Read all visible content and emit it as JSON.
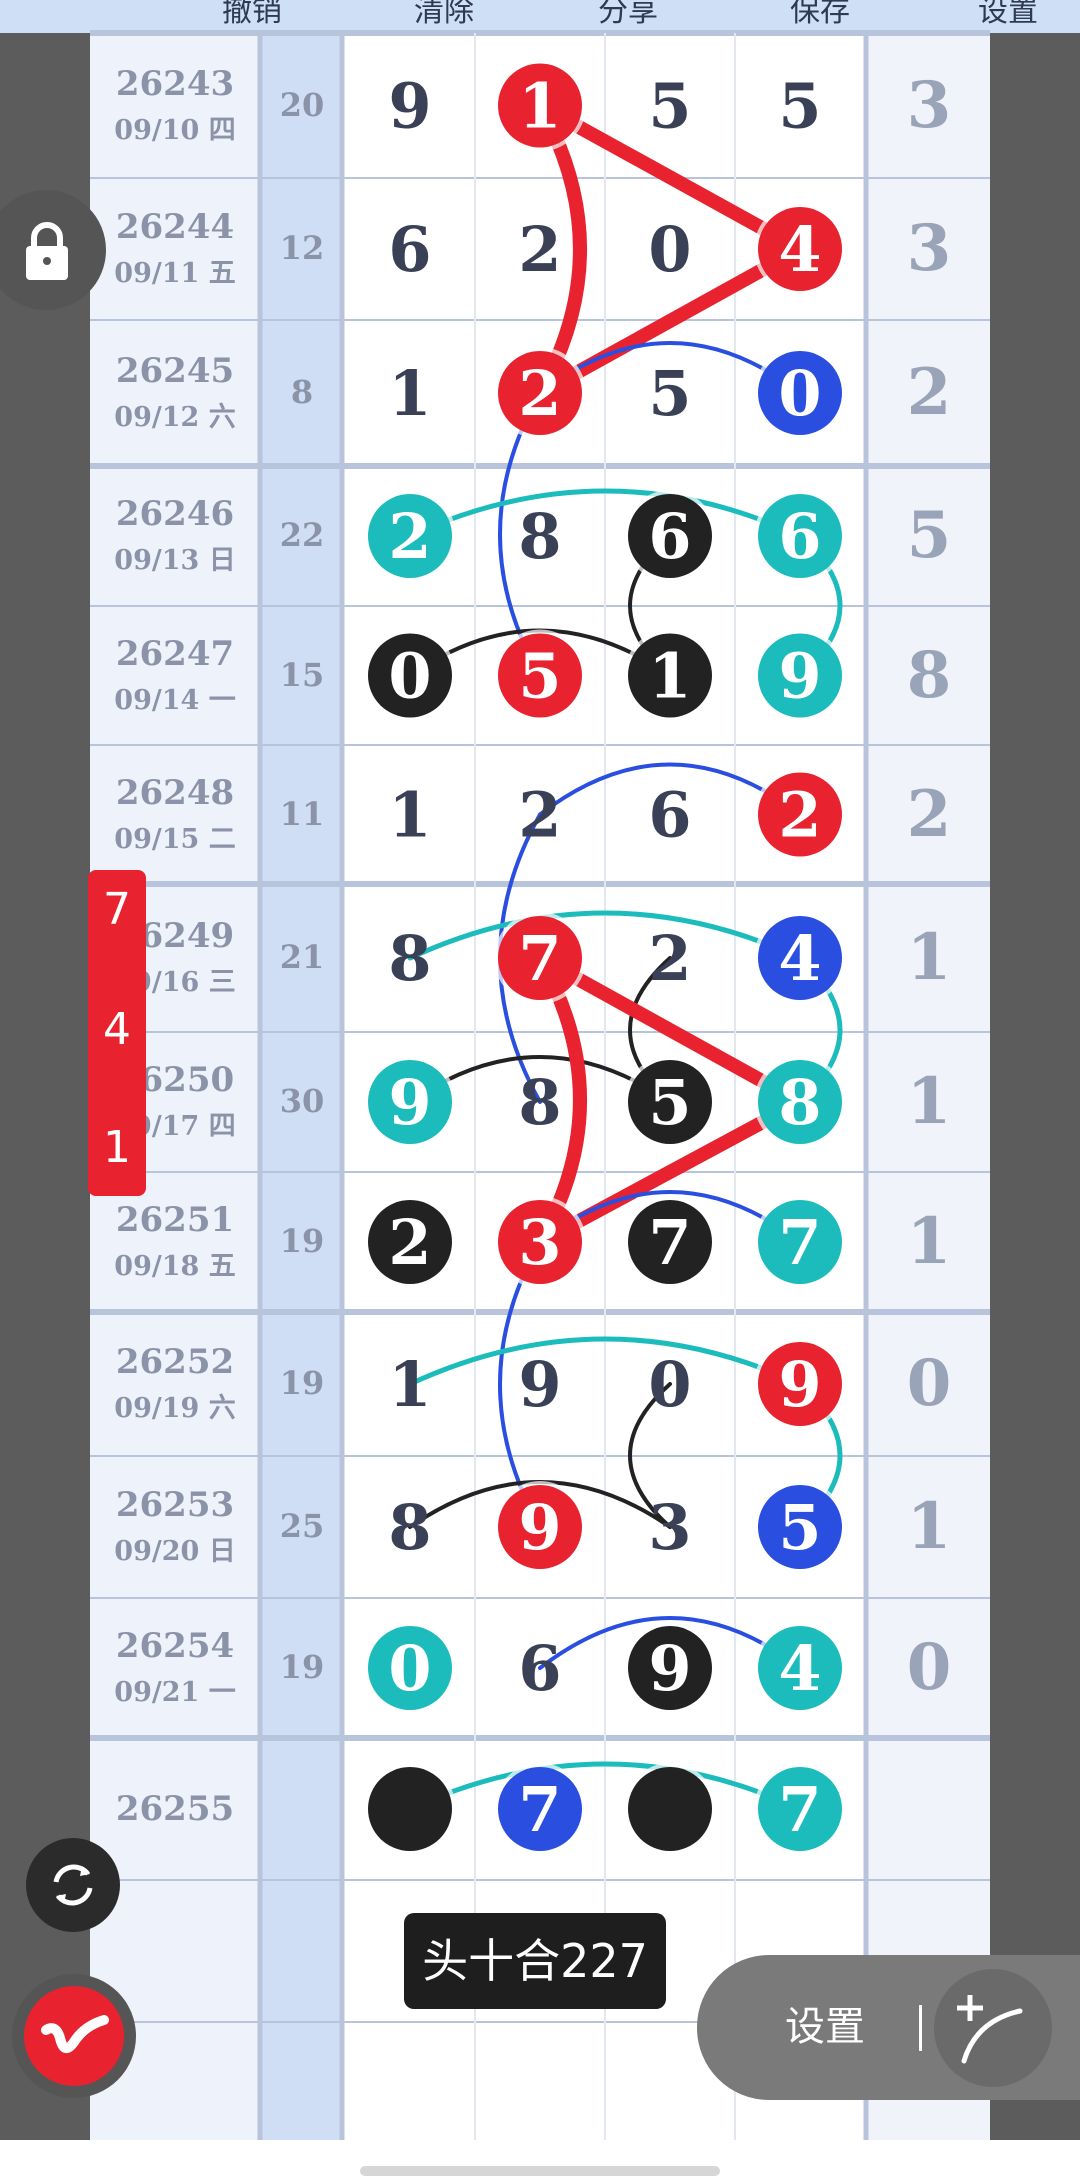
{
  "header": {
    "labels": [
      "撤销",
      "清除",
      "分享",
      "保存",
      "设置"
    ]
  },
  "rows": [
    {
      "period": "26243",
      "date": "09/10 四",
      "sum": "20",
      "digits": [
        9,
        1,
        5,
        5
      ],
      "span": "3",
      "marks": [
        "n",
        "r",
        "n",
        "n"
      ]
    },
    {
      "period": "26244",
      "date": "09/11 五",
      "sum": "12",
      "digits": [
        6,
        2,
        0,
        4
      ],
      "span": "3",
      "marks": [
        "n",
        "n",
        "n",
        "r"
      ]
    },
    {
      "period": "26245",
      "date": "09/12 六",
      "sum": "8",
      "digits": [
        1,
        2,
        5,
        0
      ],
      "span": "2",
      "marks": [
        "n",
        "r",
        "n",
        "b"
      ]
    },
    {
      "period": "26246",
      "date": "09/13 日",
      "sum": "22",
      "digits": [
        2,
        8,
        6,
        6
      ],
      "span": "5",
      "marks": [
        "c",
        "n",
        "k",
        "c"
      ]
    },
    {
      "period": "26247",
      "date": "09/14 一",
      "sum": "15",
      "digits": [
        0,
        5,
        1,
        9
      ],
      "span": "8",
      "marks": [
        "k",
        "r",
        "k",
        "c"
      ]
    },
    {
      "period": "26248",
      "date": "09/15 二",
      "sum": "11",
      "digits": [
        1,
        2,
        6,
        2
      ],
      "span": "2",
      "marks": [
        "n",
        "n",
        "n",
        "r"
      ]
    },
    {
      "period": "26249",
      "date": "09/16 三",
      "sum": "21",
      "digits": [
        8,
        7,
        2,
        4
      ],
      "span": "1",
      "marks": [
        "n",
        "r",
        "n",
        "b"
      ]
    },
    {
      "period": "26250",
      "date": "09/17 四",
      "sum": "30",
      "digits": [
        9,
        8,
        5,
        8
      ],
      "span": "1",
      "marks": [
        "c",
        "n",
        "k",
        "c"
      ]
    },
    {
      "period": "26251",
      "date": "09/18 五",
      "sum": "19",
      "digits": [
        2,
        3,
        7,
        7
      ],
      "span": "1",
      "marks": [
        "k",
        "r",
        "k",
        "c"
      ]
    },
    {
      "period": "26252",
      "date": "09/19 六",
      "sum": "19",
      "digits": [
        1,
        9,
        0,
        9
      ],
      "span": "0",
      "marks": [
        "n",
        "n",
        "n",
        "r"
      ]
    },
    {
      "period": "26253",
      "date": "09/20 日",
      "sum": "25",
      "digits": [
        8,
        9,
        3,
        5
      ],
      "span": "1",
      "marks": [
        "n",
        "r",
        "n",
        "b"
      ]
    },
    {
      "period": "26254",
      "date": "09/21 一",
      "sum": "19",
      "digits": [
        0,
        6,
        9,
        4
      ],
      "span": "0",
      "marks": [
        "c",
        "n",
        "k",
        "c"
      ]
    },
    {
      "period": "26255",
      "date": "",
      "sum": "",
      "digits": [
        "",
        7,
        "",
        7
      ],
      "span": "",
      "marks": [
        "k",
        "b",
        "k",
        "c"
      ]
    }
  ],
  "red_tab": {
    "values": [
      "7",
      "4",
      "1"
    ]
  },
  "toast_text": "头十合227",
  "pill": {
    "label": "设置"
  },
  "colors": {
    "red": "#e8222e",
    "blue": "#2a4fe0",
    "cyan": "#1cbcbc",
    "black": "#222222",
    "digit": "#3a4156",
    "grid": "#b8c4dc"
  },
  "icons": {
    "lock": "lock-icon",
    "refresh": "refresh-icon",
    "logo": "app-logo-icon",
    "pen": "pen-icon"
  }
}
